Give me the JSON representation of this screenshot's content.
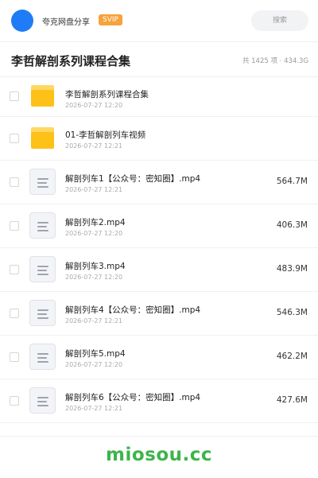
{
  "topbar": {
    "owner_name": "夸克网盘分享",
    "badge": "SVIP",
    "search_placeholder": "搜索",
    "avatar_color": "#1f7cf6"
  },
  "header": {
    "title": "李哲解剖系列课程合集",
    "summary": "共 1425 项 · 434.3G"
  },
  "items": [
    {
      "type": "folder",
      "icon": "folder-icon",
      "name": "李哲解剖系列课程合集",
      "date": "2026-07-27 12:20",
      "size": ""
    },
    {
      "type": "folder",
      "icon": "folder-icon",
      "name": "01-李哲解剖列车视频",
      "date": "2026-07-27 12:21",
      "size": ""
    },
    {
      "type": "file",
      "icon": "video-file-icon",
      "name": "解剖列车1【公众号：密知圈】.mp4",
      "date": "2026-07-27 12:21",
      "size": "564.7M"
    },
    {
      "type": "file",
      "icon": "video-file-icon",
      "name": "解剖列车2.mp4",
      "date": "2026-07-27 12:20",
      "size": "406.3M"
    },
    {
      "type": "file",
      "icon": "video-file-icon",
      "name": "解剖列车3.mp4",
      "date": "2026-07-27 12:20",
      "size": "483.9M"
    },
    {
      "type": "file",
      "icon": "video-file-icon",
      "name": "解剖列车4【公众号：密知圈】.mp4",
      "date": "2026-07-27 12:21",
      "size": "546.3M"
    },
    {
      "type": "file",
      "icon": "video-file-icon",
      "name": "解剖列车5.mp4",
      "date": "2026-07-27 12:20",
      "size": "462.2M"
    },
    {
      "type": "file",
      "icon": "video-file-icon",
      "name": "解剖列车6【公众号：密知圈】.mp4",
      "date": "2026-07-27 12:21",
      "size": "427.6M"
    }
  ],
  "footer": {
    "watermark": "miosou.cc",
    "watermark_color": "#3cb54a"
  }
}
